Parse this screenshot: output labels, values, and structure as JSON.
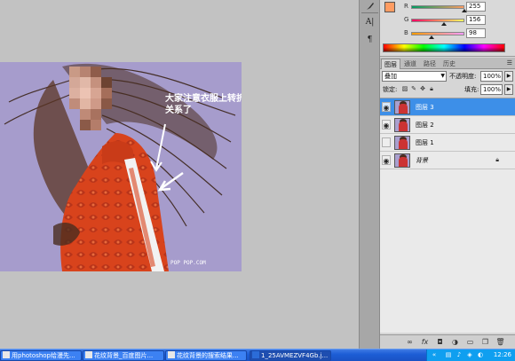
{
  "canvas": {
    "annotation_text_line1": "大家注意衣服上转折的",
    "annotation_text_line2": "关系了",
    "watermark": "POP POP.COM"
  },
  "tools": {
    "type_tool_label": "A|",
    "paragraph_label": "¶"
  },
  "color_panel": {
    "foreground_color": "#ff9c62",
    "channels": [
      {
        "label": "R",
        "value": "255",
        "level": 1.0
      },
      {
        "label": "G",
        "value": "156",
        "level": 0.61
      },
      {
        "label": "B",
        "value": "98",
        "level": 0.38
      }
    ]
  },
  "layers_panel": {
    "tabs": [
      "图层",
      "通道",
      "路径",
      "历史"
    ],
    "active_tab": 0,
    "blend_mode": "叠加",
    "opacity_label": "不透明度:",
    "opacity_value": "100%",
    "lock_label": "锁定:",
    "fill_label": "填充:",
    "fill_value": "100%",
    "layers": [
      {
        "name": "图层 3",
        "visible": true,
        "selected": true,
        "locked": false
      },
      {
        "name": "图层 2",
        "visible": true,
        "selected": false,
        "locked": false
      },
      {
        "name": "图层 1",
        "visible": false,
        "selected": false,
        "locked": false
      },
      {
        "name": "背景",
        "visible": true,
        "selected": false,
        "locked": true
      }
    ]
  },
  "taskbar": {
    "tasks": [
      {
        "label": "用photoshop给漫先...",
        "active": false
      },
      {
        "label": "花纹背景_百度图片...",
        "active": false
      },
      {
        "label": "花纹背景的搜索结果...",
        "active": false
      },
      {
        "label": "1_25AVMEZVF4Gb.j...",
        "active": true
      }
    ],
    "clock": "12:26"
  },
  "icons": {
    "eye": "eye-icon",
    "lock": "lock-icon",
    "link": "link-icon",
    "fx": "fx-icon",
    "mask": "mask-icon",
    "adjust": "adjustment-icon",
    "group": "folder-icon",
    "new_layer": "new-layer-icon",
    "trash": "trash-icon"
  }
}
